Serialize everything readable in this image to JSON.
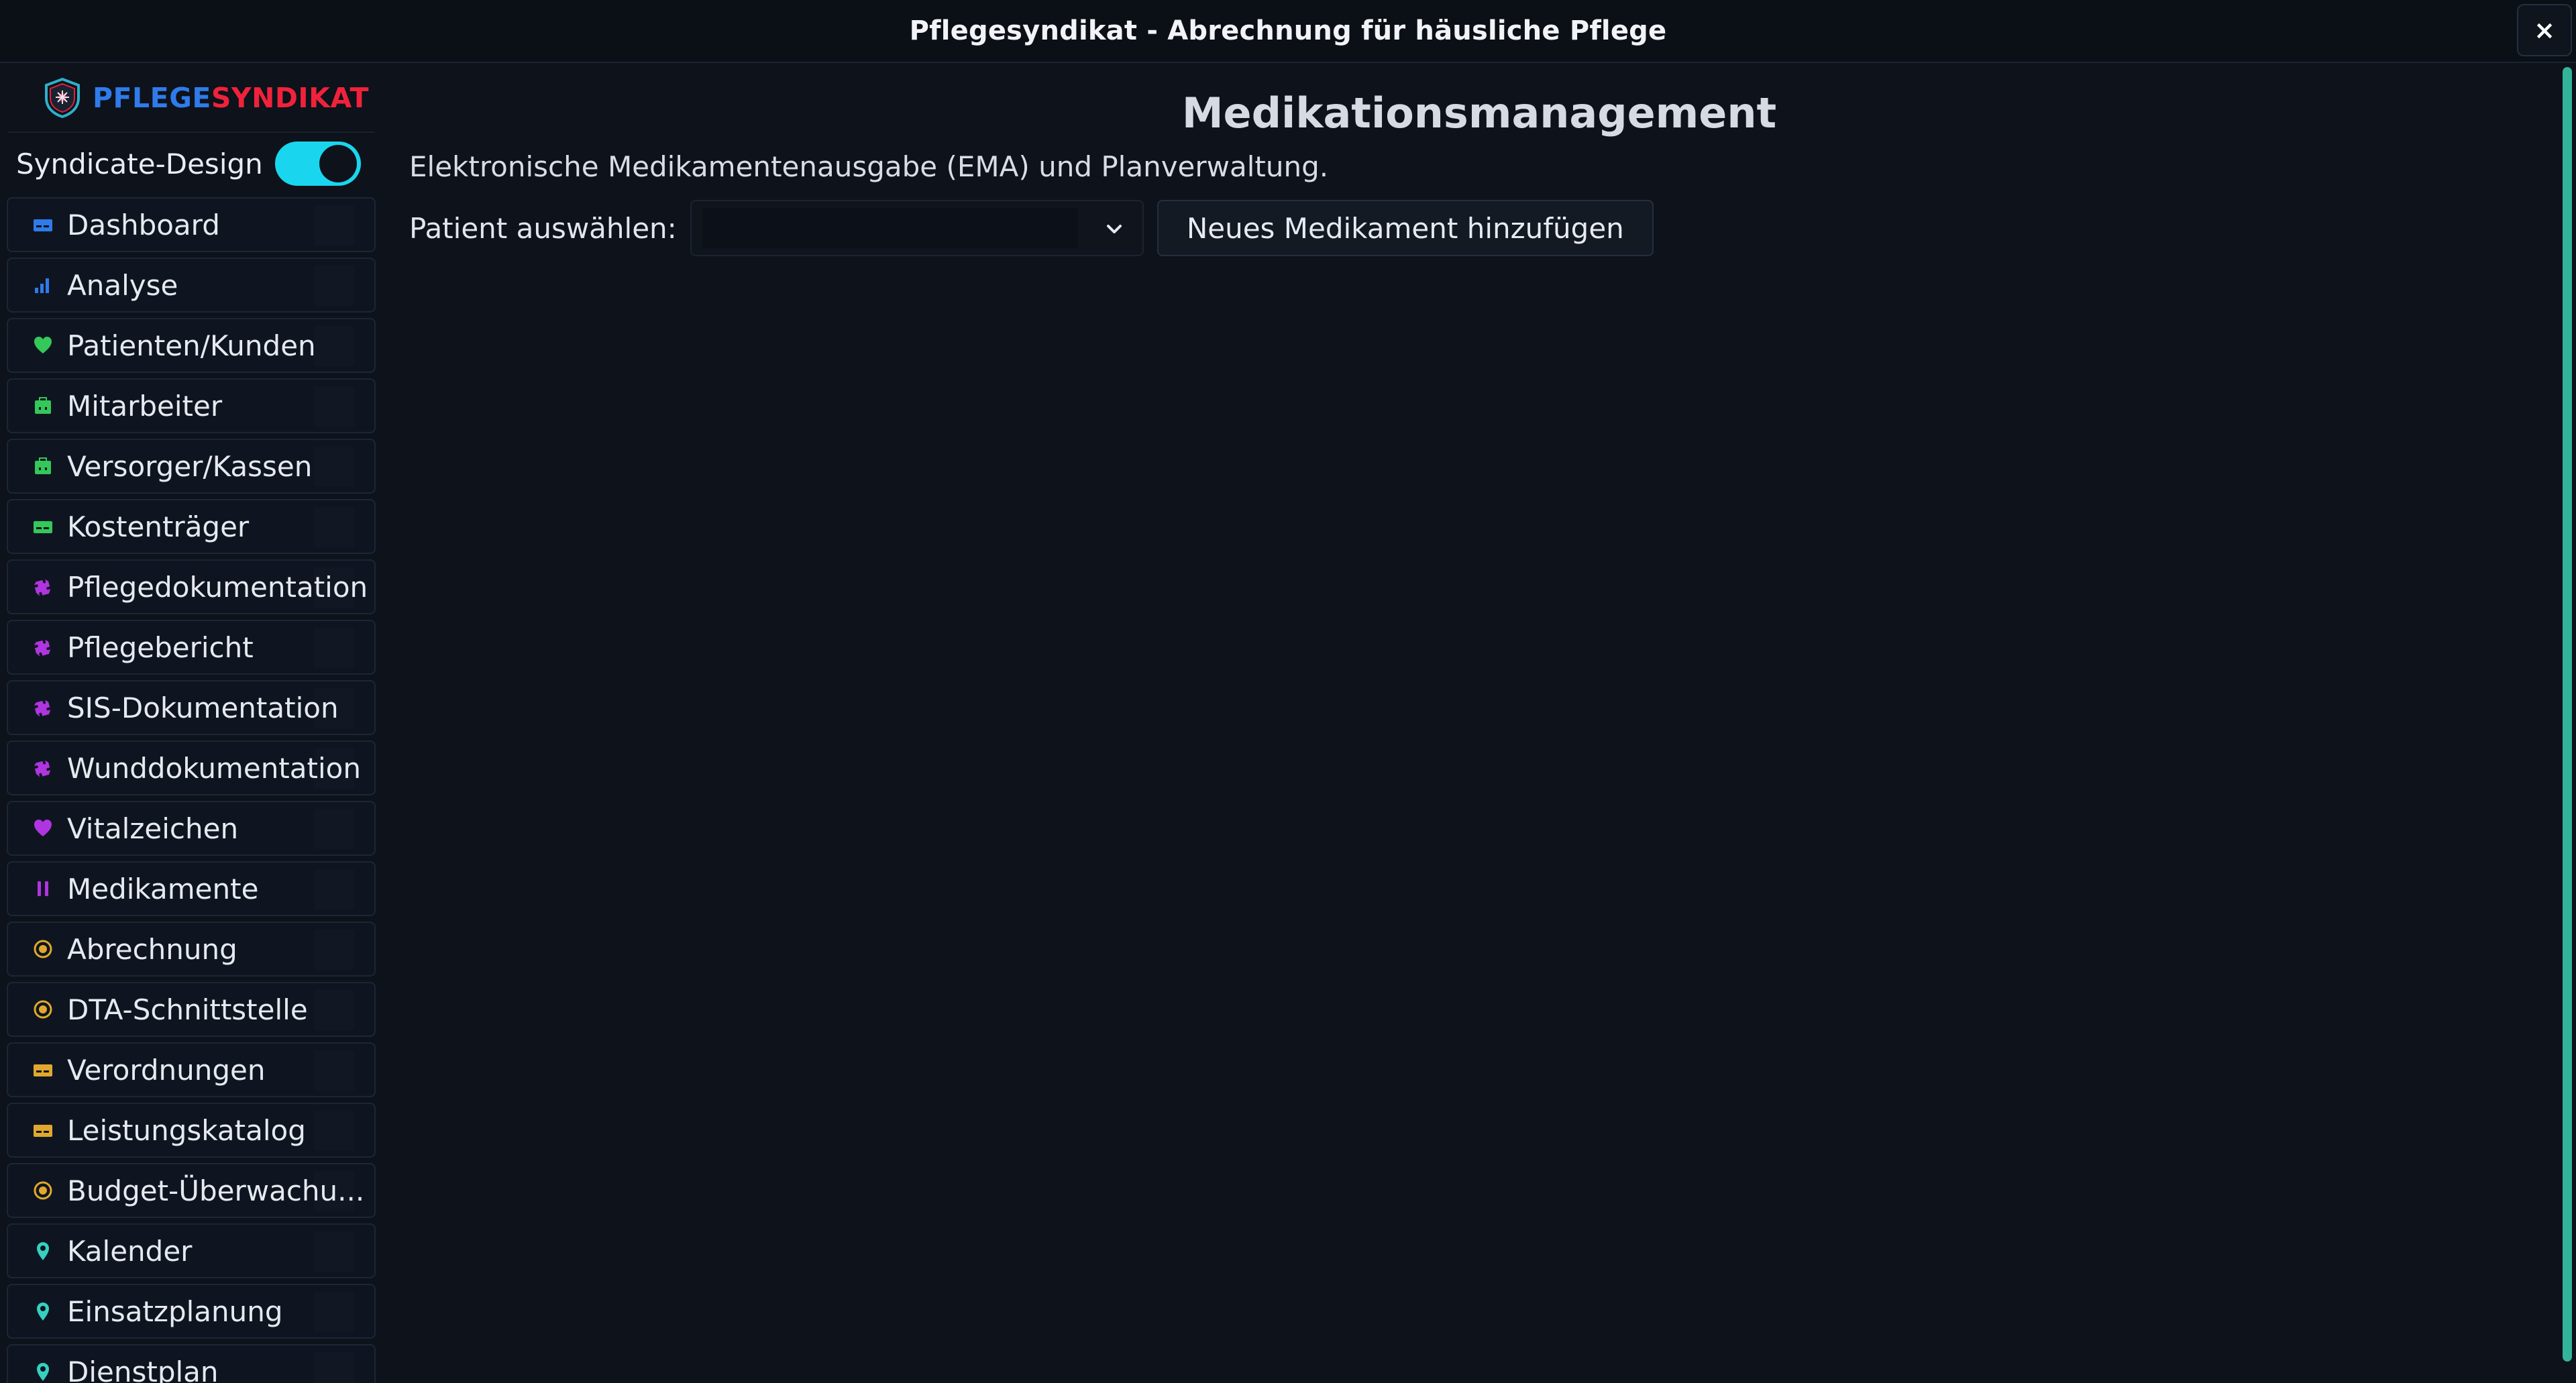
{
  "window": {
    "title": "Pflegesyndikat - Abrechnung für häusliche Pflege",
    "close_label": "×"
  },
  "logo": {
    "part1": "PFLEGE",
    "part2": "SYNDIKAT"
  },
  "toggle": {
    "label": "Syndicate-Design",
    "on": true
  },
  "nav": [
    {
      "label": "Dashboard",
      "icon": "card-icon",
      "color": "#2f7bea"
    },
    {
      "label": "Analyse",
      "icon": "bar-chart-icon",
      "color": "#2f7bea"
    },
    {
      "label": "Patienten/Kunden",
      "icon": "heart-icon",
      "color": "#34c759"
    },
    {
      "label": "Mitarbeiter",
      "icon": "briefcase-icon",
      "color": "#34c759"
    },
    {
      "label": "Versorger/Kassen",
      "icon": "briefcase-icon",
      "color": "#34c759"
    },
    {
      "label": "Kostenträger",
      "icon": "card-icon",
      "color": "#34c759"
    },
    {
      "label": "Pflegedokumentation",
      "icon": "puzzle-icon",
      "color": "#b035e0"
    },
    {
      "label": "Pflegebericht",
      "icon": "puzzle-icon",
      "color": "#b035e0"
    },
    {
      "label": "SIS-Dokumentation",
      "icon": "puzzle-icon",
      "color": "#b035e0"
    },
    {
      "label": "Wunddokumentation",
      "icon": "puzzle-icon",
      "color": "#b035e0"
    },
    {
      "label": "Vitalzeichen",
      "icon": "heart-icon",
      "color": "#b035e0"
    },
    {
      "label": "Medikamente",
      "icon": "pause-icon",
      "color": "#b035e0"
    },
    {
      "label": "Abrechnung",
      "icon": "coin-icon",
      "color": "#e0a82e"
    },
    {
      "label": "DTA-Schnittstelle",
      "icon": "coin-icon",
      "color": "#e0a82e"
    },
    {
      "label": "Verordnungen",
      "icon": "card-icon",
      "color": "#e0a82e"
    },
    {
      "label": "Leistungskatalog",
      "icon": "card-icon",
      "color": "#e0a82e"
    },
    {
      "label": "Budget-Überwachu...",
      "icon": "coin-icon",
      "color": "#e0a82e"
    },
    {
      "label": "Kalender",
      "icon": "pin-icon",
      "color": "#35d0c0"
    },
    {
      "label": "Einsatzplanung",
      "icon": "pin-icon",
      "color": "#35d0c0"
    },
    {
      "label": "Dienstplan",
      "icon": "pin-icon",
      "color": "#35d0c0"
    }
  ],
  "main": {
    "title": "Medikationsmanagement",
    "subtitle": "Elektronische Medikamentenausgabe (EMA) und Planverwaltung.",
    "patient_label": "Patient auswählen:",
    "patient_value": "",
    "add_button": "Neues Medikament hinzufügen"
  }
}
